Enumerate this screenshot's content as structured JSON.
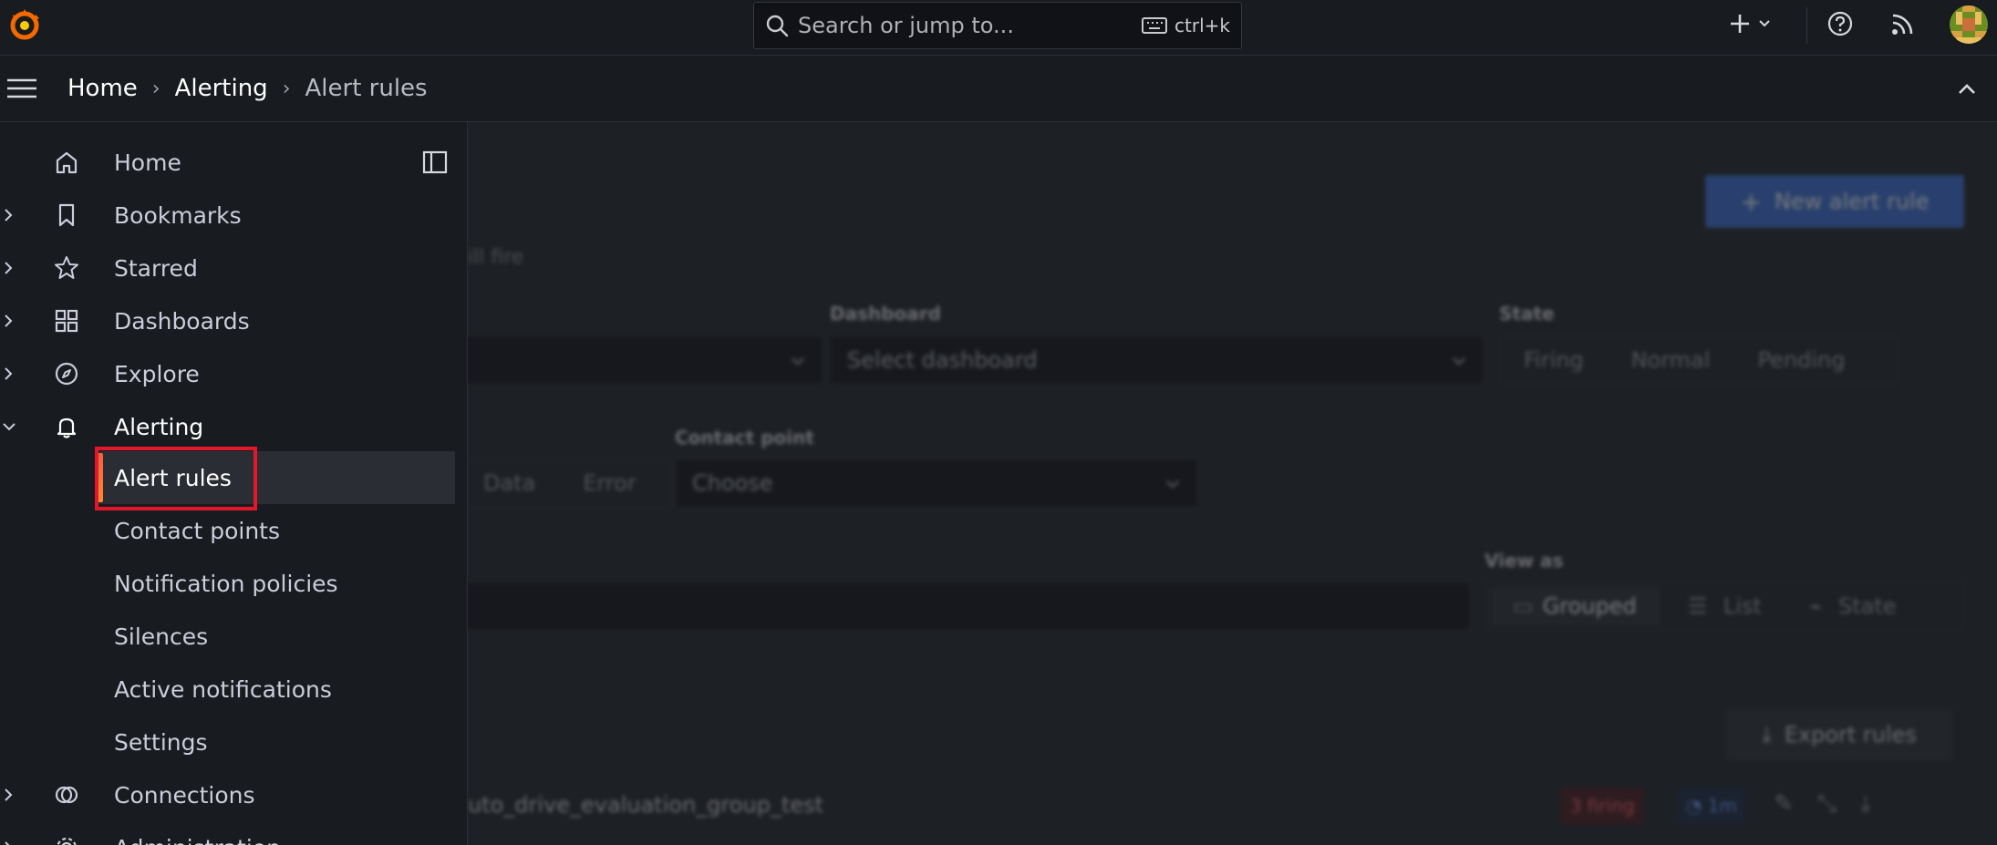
{
  "topbar": {
    "search_placeholder": "Search or jump to...",
    "search_shortcut": "ctrl+k"
  },
  "breadcrumb": {
    "items": [
      "Home",
      "Alerting",
      "Alert rules"
    ]
  },
  "sidebar": {
    "items": [
      {
        "label": "Home",
        "icon": "home-icon"
      },
      {
        "label": "Bookmarks",
        "icon": "bookmark-icon"
      },
      {
        "label": "Starred",
        "icon": "star-icon"
      },
      {
        "label": "Dashboards",
        "icon": "apps-icon"
      },
      {
        "label": "Explore",
        "icon": "compass-icon"
      },
      {
        "label": "Alerting",
        "icon": "bell-icon"
      },
      {
        "label": "Connections",
        "icon": "connections-icon"
      },
      {
        "label": "Administration",
        "icon": "gear-icon"
      }
    ],
    "alerting_children": [
      "Alert rules",
      "Contact points",
      "Notification policies",
      "Silences",
      "Active notifications",
      "Settings"
    ]
  },
  "main": {
    "new_rule_label": "New alert rule",
    "subtitle_fragment": "ill fire",
    "dashboard_label": "Dashboard",
    "dashboard_placeholder": "Select dashboard",
    "state_label": "State",
    "state_options": [
      "Firing",
      "Normal",
      "Pending"
    ],
    "health_options": [
      "Data",
      "Error"
    ],
    "contact_point_label": "Contact point",
    "contact_point_placeholder": "Choose",
    "view_as_label": "View as",
    "view_options": [
      "Grouped",
      "List",
      "State"
    ],
    "export_label": "Export rules",
    "group_name": "uto_drive_evaluation_group_test",
    "firing_badge": "3 firing",
    "interval_badge": "1m"
  },
  "colors": {
    "accent_primary": "#3d71d9",
    "active_indicator": "#f55f3e",
    "highlight_box": "#e3172a"
  }
}
